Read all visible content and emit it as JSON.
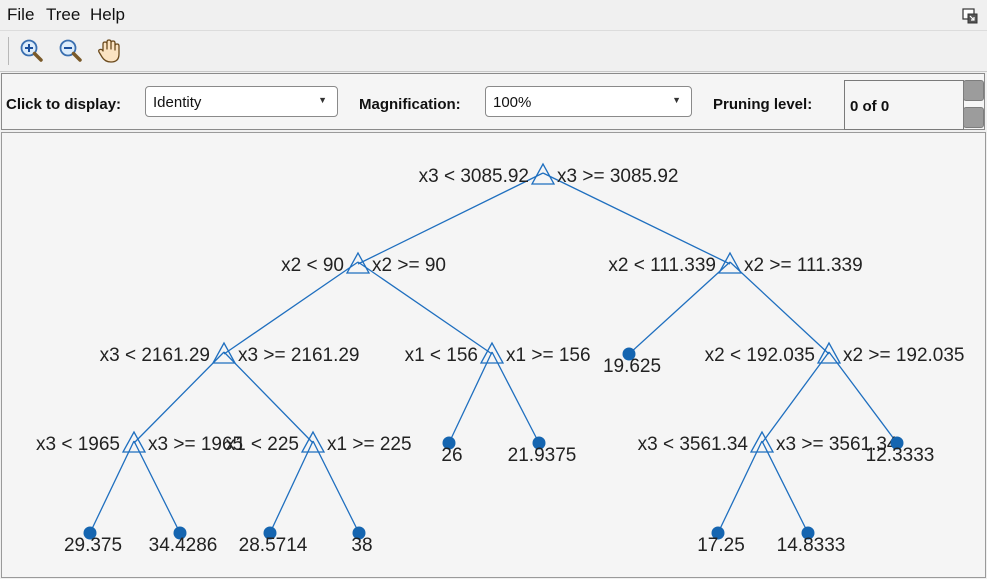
{
  "menu": {
    "file": "File",
    "tree": "Tree",
    "help": "Help"
  },
  "toolbar": {
    "zoom_in": "zoom-in-icon",
    "zoom_out": "zoom-out-icon",
    "pan": "pan-hand-icon"
  },
  "controls": {
    "click_label": "Click to display:",
    "click_value": "Identity",
    "magnification_label": "Magnification:",
    "magnification_value": "100%",
    "pruning_label": "Pruning level:",
    "pruning_value": "0 of 0"
  },
  "colors": {
    "tree": "#1f6fbf",
    "node_fill": "#1565b0",
    "text": "#222222"
  },
  "tree": {
    "splits": [
      {
        "id": "n1",
        "left": "x3 < 3085.92",
        "right": "x3 >= 3085.92"
      },
      {
        "id": "n2",
        "left": "x2 < 90",
        "right": "x2 >= 90"
      },
      {
        "id": "n3",
        "left": "x2 < 111.339",
        "right": "x2 >= 111.339"
      },
      {
        "id": "n4",
        "left": "x3 < 2161.29",
        "right": "x3 >= 2161.29"
      },
      {
        "id": "n5",
        "left": "x1 < 156",
        "right": "x1 >= 156"
      },
      {
        "id": "n7",
        "left": "x2 < 192.035",
        "right": "x2 >= 192.035"
      },
      {
        "id": "n8",
        "left": "x3 < 1965",
        "right": "x3 >= 1965"
      },
      {
        "id": "n9",
        "left": "x1 < 225",
        "right": "x1 >= 225"
      },
      {
        "id": "n14",
        "left": "x3 < 3561.34",
        "right": "x3 >= 3561.34"
      }
    ],
    "leaves": [
      {
        "id": "n6",
        "value": "19.625"
      },
      {
        "id": "n10",
        "value": "26"
      },
      {
        "id": "n11",
        "value": "21.9375"
      },
      {
        "id": "n15",
        "value": "12.3333"
      },
      {
        "id": "n16",
        "value": "29.375"
      },
      {
        "id": "n17",
        "value": "34.4286"
      },
      {
        "id": "n18",
        "value": "28.5714"
      },
      {
        "id": "n19",
        "value": "38"
      },
      {
        "id": "n20",
        "value": "17.25"
      },
      {
        "id": "n21",
        "value": "14.8333"
      }
    ],
    "edges": [
      [
        "n1",
        "n2"
      ],
      [
        "n1",
        "n3"
      ],
      [
        "n2",
        "n4"
      ],
      [
        "n2",
        "n5"
      ],
      [
        "n3",
        "n6"
      ],
      [
        "n3",
        "n7"
      ],
      [
        "n4",
        "n8"
      ],
      [
        "n4",
        "n9"
      ],
      [
        "n5",
        "n10"
      ],
      [
        "n5",
        "n11"
      ],
      [
        "n7",
        "n14"
      ],
      [
        "n7",
        "n15"
      ],
      [
        "n8",
        "n16"
      ],
      [
        "n8",
        "n17"
      ],
      [
        "n9",
        "n18"
      ],
      [
        "n9",
        "n19"
      ],
      [
        "n14",
        "n20"
      ],
      [
        "n14",
        "n21"
      ]
    ]
  }
}
